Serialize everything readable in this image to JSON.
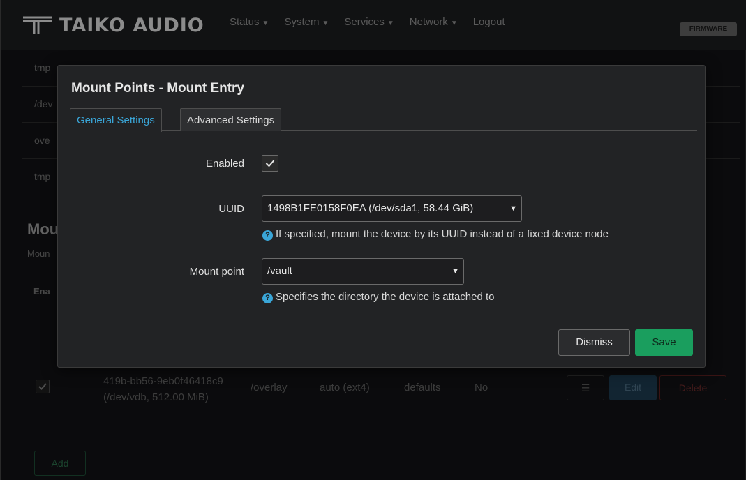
{
  "navbar": {
    "brand": "TAIKO AUDIO",
    "menu": [
      {
        "label": "Status"
      },
      {
        "label": "System"
      },
      {
        "label": "Services"
      },
      {
        "label": "Network"
      },
      {
        "label": "Logout"
      }
    ],
    "firmware_badge": "FIRMWARE"
  },
  "background": {
    "rows": [
      "tmp",
      "/dev",
      "ove",
      "tmp"
    ],
    "heading": "Mou",
    "subheading": "Moun",
    "table_header": "Ena",
    "entry": {
      "enabled": true,
      "device": "419b-bb56-9eb0f46418c9 (/dev/vdb, 512.00 MiB)",
      "mount_point": "/overlay",
      "filesystem": "auto (ext4)",
      "options": "defaults",
      "root": "No",
      "menu_icon": "hamburger-icon",
      "edit_label": "Edit",
      "delete_label": "Delete"
    },
    "add_label": "Add"
  },
  "modal": {
    "title": "Mount Points - Mount Entry",
    "tabs": [
      {
        "label": "General Settings",
        "active": true
      },
      {
        "label": "Advanced Settings",
        "active": false
      }
    ],
    "fields": {
      "enabled": {
        "label": "Enabled",
        "checked": true
      },
      "uuid": {
        "label": "UUID",
        "value": "1498B1FE0158F0EA (/dev/sda1, 58.44 GiB)",
        "help": "If specified, mount the device by its UUID instead of a fixed device node"
      },
      "mount_point": {
        "label": "Mount point",
        "value": "/vault",
        "help": "Specifies the directory the device is attached to"
      }
    },
    "dismiss_label": "Dismiss",
    "save_label": "Save"
  },
  "colors": {
    "accent": "#3aa6d8",
    "save": "#1a9e5e",
    "delete": "#5a1f1f"
  }
}
